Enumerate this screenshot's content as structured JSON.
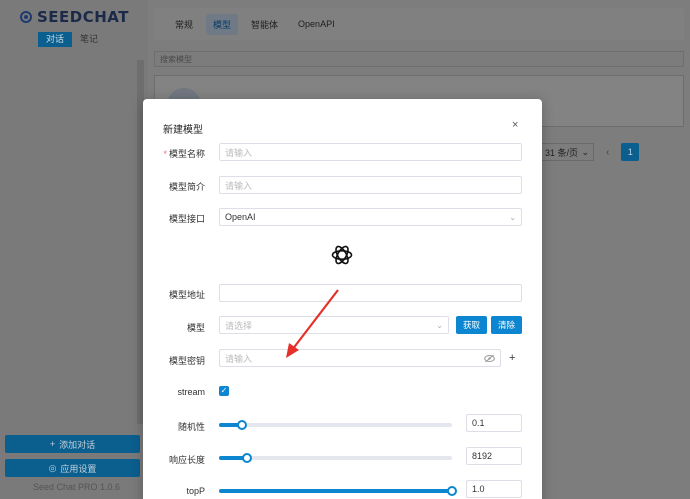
{
  "sidebar": {
    "brand": "SEEDCHAT",
    "tabs": [
      {
        "label": "对话",
        "active": true
      },
      {
        "label": "笔记",
        "active": false
      }
    ],
    "add_button": "添加对话",
    "settings_button": "应用设置",
    "version": "Seed Chat PRO 1.0.6"
  },
  "topnav": {
    "tabs": [
      "常规",
      "模型",
      "智能体",
      "OpenAPI"
    ],
    "active": "模型"
  },
  "search": {
    "placeholder": "搜索模型"
  },
  "pagination": {
    "page_size": "31 条/页",
    "current_page": "1"
  },
  "modal": {
    "title": "新建模型",
    "close": "×",
    "fields": {
      "name": {
        "label": "模型名称",
        "placeholder": "请输入",
        "required_mark": "*"
      },
      "desc": {
        "label": "模型简介",
        "placeholder": "请输入"
      },
      "api": {
        "label": "模型接口",
        "value": "OpenAI"
      },
      "url": {
        "label": "模型地址",
        "value": ""
      },
      "model": {
        "label": "模型",
        "placeholder": "请选择",
        "fetch_button": "获取",
        "clear_button": "清除"
      },
      "key": {
        "label": "模型密钥",
        "placeholder": "请输入",
        "add": "+"
      },
      "stream": {
        "label": "stream",
        "checked": true
      },
      "temperature": {
        "label": "随机性",
        "value": "0.1",
        "fraction": 0.1
      },
      "max_tokens": {
        "label": "响应长度",
        "value": "8192",
        "fraction": 0.12
      },
      "top_p": {
        "label": "topP",
        "value": "1.0",
        "fraction": 1.0
      }
    }
  },
  "colors": {
    "primary": "#0c86d1",
    "required": "#f56c6c",
    "arrow": "#e5302a"
  }
}
